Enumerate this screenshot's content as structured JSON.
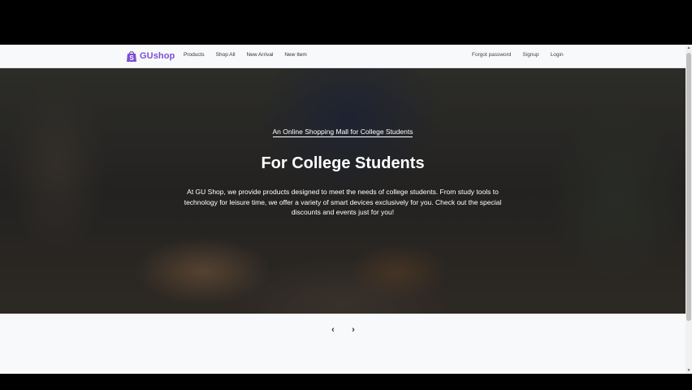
{
  "brand": {
    "name": "GUshop",
    "icon": "shopping-bag-icon",
    "color": "#7b4fd6"
  },
  "nav": {
    "links": [
      "Products",
      "Shop All",
      "New Arrival",
      "New Item"
    ],
    "right": [
      "Forgot password",
      "Signup",
      "Login"
    ]
  },
  "hero": {
    "subtitle": "An Online Shopping Mall for College Students",
    "title": "For College Students",
    "body": "At GU Shop, we provide products designed to meet the needs of college students. From study tools to technology for leisure time, we offer a variety of smart devices exclusively for you. Check out the special discounts and events just for you!"
  },
  "carousel": {
    "prev_icon": "‹",
    "next_icon": "›"
  },
  "scrollbar": {
    "up": "▲",
    "down": "▼"
  }
}
